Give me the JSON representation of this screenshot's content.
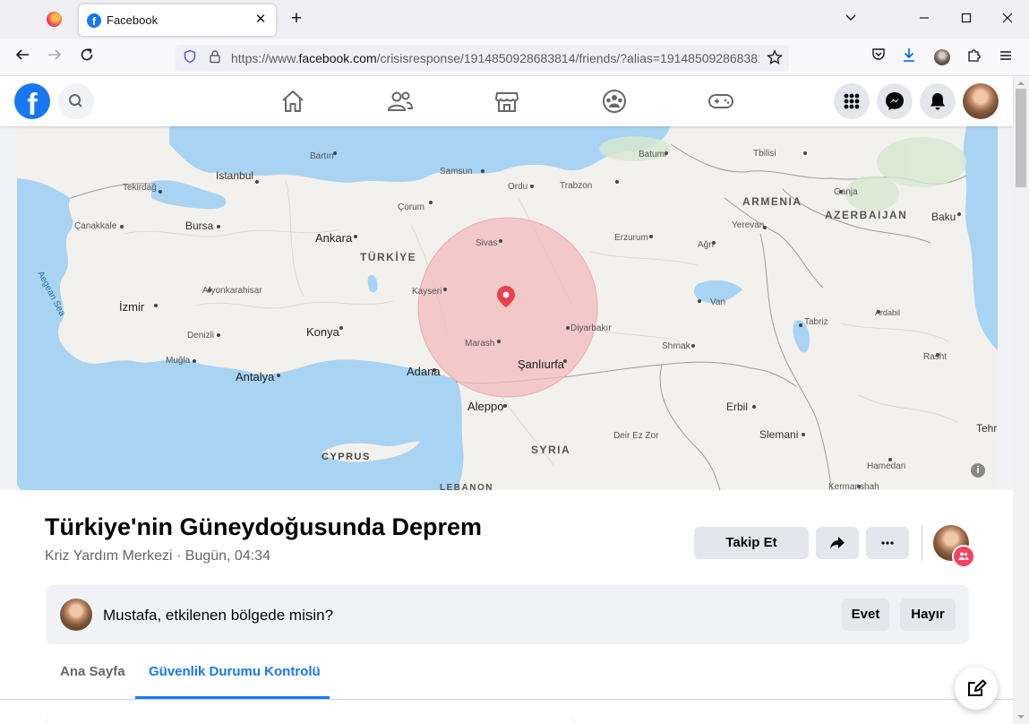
{
  "browser": {
    "tab_title": "Facebook",
    "favicon_letter": "f",
    "url_prefix": "https://www.",
    "url_domain": "facebook.com",
    "url_path": "/crisisresponse/1914850928683814/friends/?alias=1914850928683814",
    "icons": [
      "firefox-icon",
      "close-icon",
      "plus-icon",
      "chevron-down-icon",
      "minimize-icon",
      "maximize-icon",
      "window-close-icon",
      "back-icon",
      "forward-icon",
      "reload-icon",
      "shield-icon",
      "lock-icon",
      "star-icon",
      "pocket-icon",
      "download-icon",
      "profile-icon",
      "extensions-icon",
      "menu-icon"
    ]
  },
  "facebook": {
    "logo_letter": "f",
    "nav_icons": [
      "home-icon",
      "friends-icon",
      "marketplace-icon",
      "groups-icon",
      "gaming-icon"
    ],
    "right_icons": [
      "menu-grid-icon",
      "messenger-icon",
      "notifications-icon"
    ]
  },
  "map": {
    "labels": {
      "istanbul": "Istanbul",
      "tekirdag": "Tekirdağ",
      "canakkale": "Çanakkale",
      "bursa": "Bursa",
      "izmir": "İzmir",
      "afyon": "Afyonkarahisar",
      "denizli": "Denizli",
      "mugla": "Muğla",
      "antalya": "Antalya",
      "konya": "Konya",
      "ankara": "Ankara",
      "corum": "Çorum",
      "bartin": "Bartın",
      "samsun": "Samsun",
      "ordu": "Ordu",
      "trabzon": "Trabzon",
      "batumi": "Batumi",
      "tbilisi": "Tbilisi",
      "ganja": "Ganja",
      "armenia": "ARMENIA",
      "azerbaijan": "AZERBAIJAN",
      "baku": "Baku",
      "yerevan": "Yerevan",
      "erzurum": "Erzurum",
      "agri": "Ağrı",
      "turkiye": "TÜRKİYE",
      "sivas": "Sivas",
      "kayseri": "Kayseri",
      "diyarbakir": "Diyarbakır",
      "marash": "Marash",
      "sanliurfa": "Şanlıurfa",
      "adana": "Adana",
      "aleppo": "Aleppo",
      "syria": "SYRIA",
      "deir": "Deir Ez Zor",
      "cyprus": "CYPRUS",
      "lebanon": "LEBANON",
      "van": "Van",
      "tabriz": "Tabriz",
      "ardabil": "Ardabil",
      "shrnak": "Shrnak",
      "rasht": "Rasht",
      "erbil": "Erbil",
      "slemani": "Slemani",
      "hamedan": "Hamedan",
      "kermanshah": "Kermanshah",
      "tehran": "Tehr",
      "aegean": "Aegean Sea"
    },
    "info_glyph": "i",
    "marker_icon": "location-pin-icon"
  },
  "crisis": {
    "title": "Türkiye'nin Güneydoğusunda Deprem",
    "subtitle": "Kriz Yardım Merkezi · Bugün, 04:34",
    "follow_button": "Takip Et",
    "share_icon": "share-icon",
    "more_icon": "more-icon",
    "prompt_text": "Mustafa, etkilenen bölgede misin?",
    "yes_button": "Evet",
    "no_button": "Hayır",
    "tabs": [
      {
        "label": "Ana Sayfa",
        "active": false
      },
      {
        "label": "Güvenlik Durumu Kontrolü",
        "active": true
      }
    ],
    "compose_icon": "compose-icon"
  },
  "colors": {
    "brand": "#1877f2",
    "marker": "#e8424f",
    "affected_area": "#f2b9bb"
  }
}
